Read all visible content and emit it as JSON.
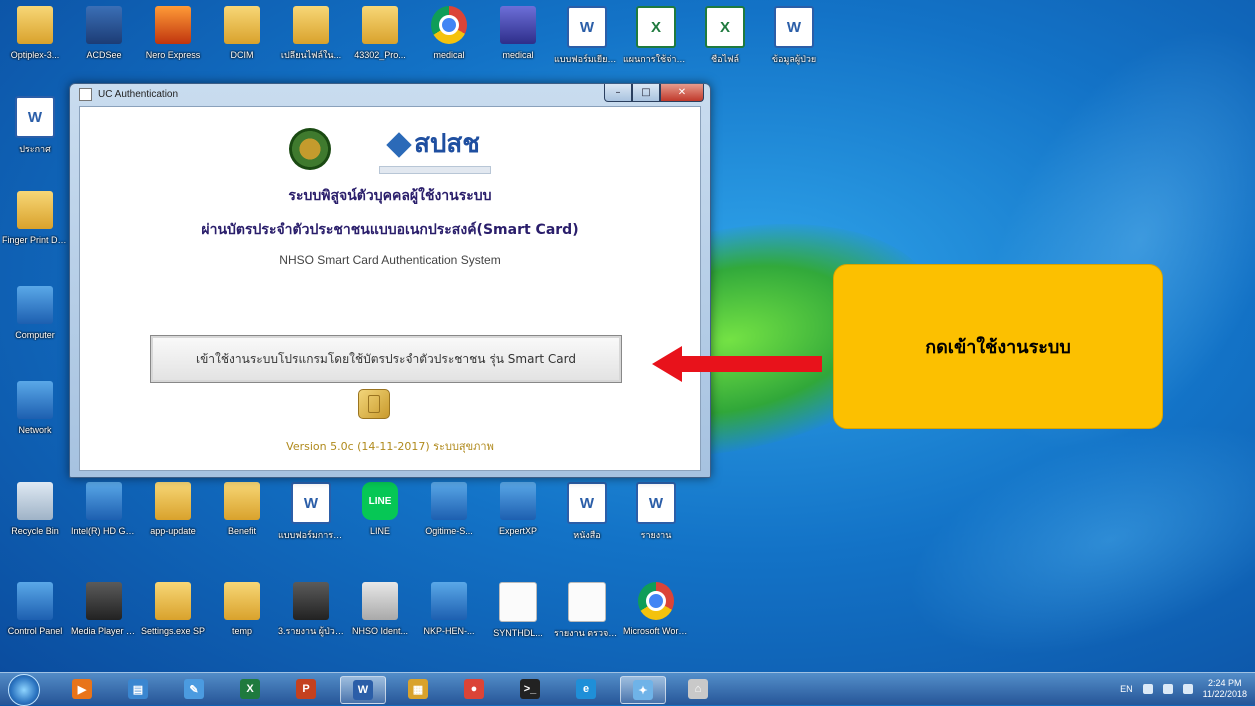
{
  "desktop": {
    "top_row": [
      {
        "label": "Optiplex-3...",
        "icon": "folder-icon",
        "kind": "folder"
      },
      {
        "label": "ACDSee",
        "icon": "camera-icon",
        "kind": "cam"
      },
      {
        "label": "Nero Express",
        "icon": "nero-icon",
        "kind": "fire"
      },
      {
        "label": "DCIM",
        "icon": "folder-icon",
        "kind": "folder"
      },
      {
        "label": "เปลี่ยนไฟล์ใน...",
        "icon": "folder-icon",
        "kind": "folder"
      },
      {
        "label": "43302_Pro...",
        "icon": "folder-icon",
        "kind": "folder"
      },
      {
        "label": "medical",
        "icon": "chrome-icon",
        "kind": "chrome"
      },
      {
        "label": "medical",
        "icon": "app-icon",
        "kind": "purple"
      },
      {
        "label": "แบบฟอร์มเยี่ยม...",
        "icon": "word-icon",
        "kind": "word"
      },
      {
        "label": "แผนการใช้จ่าย...",
        "icon": "excel-icon",
        "kind": "excel"
      },
      {
        "label": "ชื่อไฟล์",
        "icon": "excel-icon",
        "kind": "excel"
      },
      {
        "label": "ข้อมูลผู้ป่วย",
        "icon": "word-icon",
        "kind": "word"
      }
    ],
    "left_column": [
      {
        "label": "ประกาศ",
        "icon": "word-icon",
        "kind": "word"
      },
      {
        "label": "Finger Print Driver",
        "icon": "folder-icon",
        "kind": "folder"
      },
      {
        "label": "Computer",
        "icon": "computer-icon",
        "kind": "blue"
      },
      {
        "label": "Network",
        "icon": "network-icon",
        "kind": "blue"
      }
    ],
    "row2": [
      {
        "label": "Recycle Bin",
        "icon": "recycle-bin-icon",
        "kind": "recycle"
      },
      {
        "label": "Intel(R) HD Graphics...",
        "icon": "intel-icon",
        "kind": "blue"
      },
      {
        "label": "app-update",
        "icon": "folder-icon",
        "kind": "folder"
      },
      {
        "label": "Benefit",
        "icon": "folder-icon",
        "kind": "folder"
      },
      {
        "label": "แบบฟอร์มการ ตรวจสอบ",
        "icon": "word-icon",
        "kind": "word"
      },
      {
        "label": "LINE",
        "icon": "line-icon",
        "kind": "line"
      },
      {
        "label": "Ogitime-S...",
        "icon": "network-icon",
        "kind": "blue"
      },
      {
        "label": "ExpertXP",
        "icon": "app-icon",
        "kind": "blue"
      },
      {
        "label": "หนังสือ",
        "icon": "word-icon",
        "kind": "word"
      },
      {
        "label": "รายงาน",
        "icon": "word-icon",
        "kind": "word"
      }
    ],
    "row3": [
      {
        "label": "Control Panel",
        "icon": "control-panel-icon",
        "kind": "blue"
      },
      {
        "label": "Media Player Classic",
        "icon": "media-player-icon",
        "kind": "dark"
      },
      {
        "label": "Settings.exe SP",
        "icon": "folder-icon",
        "kind": "folder"
      },
      {
        "label": "temp",
        "icon": "folder-icon",
        "kind": "folder"
      },
      {
        "label": "3.รายงาน ผู้ป่วยใน...",
        "icon": "app-icon",
        "kind": "dark"
      },
      {
        "label": "NHSO Ident...",
        "icon": "app-icon",
        "kind": "gray"
      },
      {
        "label": "NKP-HEN-...",
        "icon": "network-icon",
        "kind": "blue"
      },
      {
        "label": "SYNTHDL...",
        "icon": "file-icon",
        "kind": "paper"
      },
      {
        "label": "รายงาน ตรวจสอบ",
        "icon": "file-icon",
        "kind": "paper"
      },
      {
        "label": "Microsoft Word(2010)",
        "icon": "chrome-icon",
        "kind": "chrome"
      }
    ]
  },
  "window": {
    "title": "UC Authentication",
    "minimize": "–",
    "maximize": "□",
    "close": "✕",
    "nhso_logo_text": "สปสช",
    "heading_line1": "ระบบพิสูจน์ตัวบุคคลผู้ใช้งานระบบ",
    "heading_line2": "ผ่านบัตรประจำตัวประชาชนแบบอเนกประสงค์(Smart Card)",
    "english_title": "NHSO Smart Card Authentication System",
    "smartcard_button": "เข้าใช้งานระบบโปรแกรมโดยใช้บัตรประจำตัวประชาชน รุ่น Smart Card",
    "version": "Version 5.0c (14-11-2017) ระบบสุขภาพ"
  },
  "callout": {
    "text": "กดเข้าใช้งานระบบ",
    "color": "#fcc000",
    "arrow_color": "#e8121b"
  },
  "taskbar": {
    "items": [
      {
        "icon": "media-player-icon",
        "kind": "#e8741a",
        "glyph": "▶"
      },
      {
        "icon": "explorer-icon",
        "kind": "#3a86d0",
        "glyph": "▤"
      },
      {
        "icon": "paint-icon",
        "kind": "#4b9be0",
        "glyph": "✎"
      },
      {
        "icon": "excel-icon",
        "kind": "#1f7a3e",
        "glyph": "X"
      },
      {
        "icon": "powerpoint-icon",
        "kind": "#c4411f",
        "glyph": "P"
      },
      {
        "icon": "word-icon",
        "kind": "#2b5ea8",
        "glyph": "W"
      },
      {
        "icon": "folder-icon",
        "kind": "#d9a22c",
        "glyph": "▦"
      },
      {
        "icon": "chrome-icon",
        "kind": "#db4437",
        "glyph": "●"
      },
      {
        "icon": "cmd-icon",
        "kind": "#222222",
        "glyph": ">_"
      },
      {
        "icon": "internet-explorer-icon",
        "kind": "#1f8fd8",
        "glyph": "e"
      },
      {
        "icon": "network-app-icon",
        "kind": "#6fb3e8",
        "glyph": "✦"
      },
      {
        "icon": "smart-card-app-icon",
        "kind": "#c9c9c9",
        "glyph": "⌂"
      }
    ],
    "language": "EN",
    "time": "2:24 PM",
    "date": "11/22/2018"
  }
}
